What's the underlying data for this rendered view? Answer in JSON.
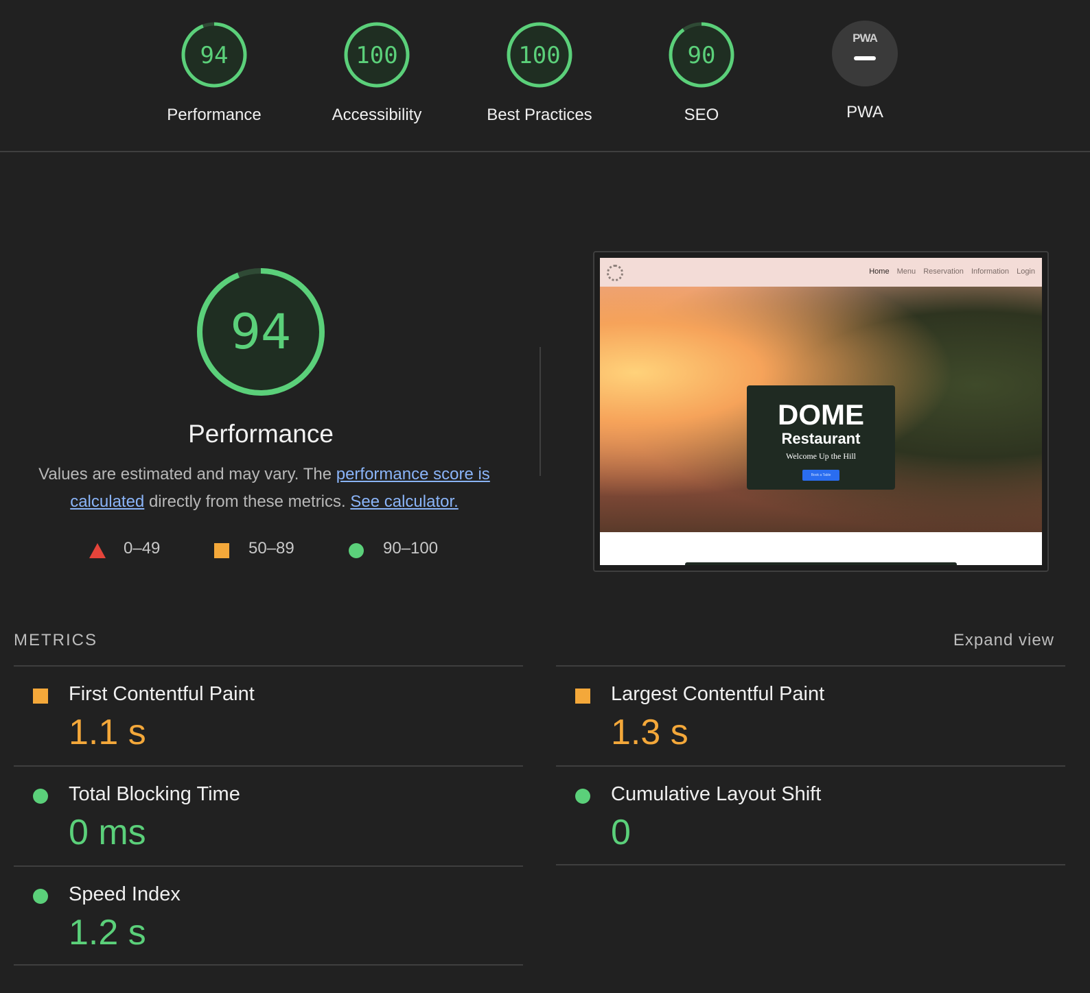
{
  "colors": {
    "pass": "#5bd07a",
    "average": "#f4a83a",
    "fail": "#e5443a",
    "background": "#212121",
    "link": "#8ab4f8"
  },
  "categories": [
    {
      "label": "Performance",
      "score": "94",
      "value": 94
    },
    {
      "label": "Accessibility",
      "score": "100",
      "value": 100
    },
    {
      "label": "Best Practices",
      "score": "100",
      "value": 100
    },
    {
      "label": "SEO",
      "score": "90",
      "value": 90
    },
    {
      "label": "PWA",
      "badge": "PWA",
      "icon": "pwa-dash-icon"
    }
  ],
  "performance": {
    "score": "94",
    "value": 94,
    "title": "Performance",
    "desc_prefix": "Values are estimated and may vary. The ",
    "desc_link1": "performance score is calculated",
    "desc_middle": " directly from these metrics. ",
    "desc_link2": "See calculator."
  },
  "legend": [
    {
      "icon": "triangle-fail-icon",
      "range": "0–49"
    },
    {
      "icon": "square-average-icon",
      "range": "50–89"
    },
    {
      "icon": "circle-pass-icon",
      "range": "90–100"
    }
  ],
  "screenshot": {
    "nav_links": [
      "Home",
      "Menu",
      "Reservation",
      "Information",
      "Login"
    ],
    "card_title": "DOME",
    "card_subtitle": "Restaurant",
    "card_tagline": "Welcome Up the Hill",
    "card_button": "Book a Table"
  },
  "metrics": {
    "header": "METRICS",
    "expand": "Expand view",
    "items": [
      {
        "label": "First Contentful Paint",
        "value": "1.1 s",
        "status": "average",
        "icon": "square-average-icon"
      },
      {
        "label": "Largest Contentful Paint",
        "value": "1.3 s",
        "status": "average",
        "icon": "square-average-icon"
      },
      {
        "label": "Total Blocking Time",
        "value": "0 ms",
        "status": "pass",
        "icon": "circle-pass-icon"
      },
      {
        "label": "Cumulative Layout Shift",
        "value": "0",
        "status": "pass",
        "icon": "circle-pass-icon"
      },
      {
        "label": "Speed Index",
        "value": "1.2 s",
        "status": "pass",
        "icon": "circle-pass-icon"
      }
    ]
  }
}
